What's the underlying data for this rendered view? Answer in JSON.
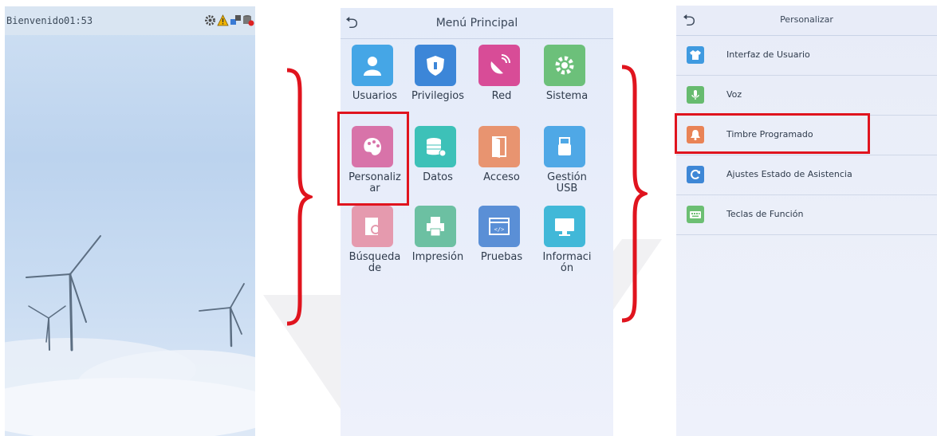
{
  "screen1": {
    "welcome": "Bienvenido",
    "time": "01:53",
    "status_icons": [
      "gear-icon",
      "warning-icon",
      "network-icon",
      "database-icon"
    ]
  },
  "screen2": {
    "title": "Menú Principal",
    "back_icon": "back-arrow-icon",
    "items": [
      {
        "label": "Usuarios",
        "icon": "users-icon",
        "color": "#45a6e6"
      },
      {
        "label": "Privilegios",
        "icon": "shield-icon",
        "color": "#3c86d8"
      },
      {
        "label": "Red",
        "icon": "satellite-dish-icon",
        "color": "#d84c97"
      },
      {
        "label": "Sistema",
        "icon": "gear-icon",
        "color": "#6cc07a"
      },
      {
        "label": "Personaliz\nar",
        "icon": "palette-icon",
        "color": "#d873a9"
      },
      {
        "label": "Datos",
        "icon": "database-icon",
        "color": "#3dc1b8"
      },
      {
        "label": "Acceso",
        "icon": "door-icon",
        "color": "#e89470"
      },
      {
        "label": "Gestión\nUSB",
        "icon": "usb-icon",
        "color": "#4fa8e6"
      },
      {
        "label": "Búsqueda\nde",
        "icon": "document-search-icon",
        "color": "#e59aae"
      },
      {
        "label": "Impresión",
        "icon": "printer-icon",
        "color": "#6cc0a2"
      },
      {
        "label": "Pruebas",
        "icon": "code-icon",
        "color": "#5a8fd6"
      },
      {
        "label": "Informaci\nón",
        "icon": "monitor-icon",
        "color": "#41b8d8"
      }
    ],
    "highlighted": "Personaliz\nar"
  },
  "screen3": {
    "title": "Personalizar",
    "back_icon": "back-arrow-icon",
    "items": [
      {
        "label": "Interfaz de Usuario",
        "icon": "tshirt-icon",
        "color": "#3f9ae0"
      },
      {
        "label": "Voz",
        "icon": "microphone-icon",
        "color": "#67bb6f"
      },
      {
        "label": "Timbre Programado",
        "icon": "bell-icon",
        "color": "#e98356"
      },
      {
        "label": "Ajustes Estado de Asistencia",
        "icon": "refresh-icon",
        "color": "#3e87d6"
      },
      {
        "label": "Teclas de Función",
        "icon": "keyboard-icon",
        "color": "#6cbf73"
      }
    ],
    "highlighted": "Timbre Programado"
  },
  "colors": {
    "highlight": "#e0141e",
    "brace": "#e0141e"
  }
}
